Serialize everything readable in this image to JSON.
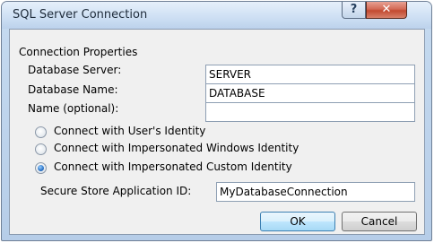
{
  "window": {
    "title": "SQL Server Connection"
  },
  "titlebar": {
    "help_glyph": "?",
    "close_glyph": "✕"
  },
  "section": {
    "heading": "Connection Properties"
  },
  "fields": {
    "server_label": "Database Server:",
    "server_value": "SERVER",
    "name_label": "Database Name:",
    "name_value": "DATABASE",
    "optional_label": "Name (optional):",
    "optional_value": ""
  },
  "identity": {
    "options": [
      {
        "label": "Connect with User's Identity",
        "checked": false
      },
      {
        "label": "Connect with Impersonated Windows Identity",
        "checked": false
      },
      {
        "label": "Connect with Impersonated Custom Identity",
        "checked": true
      }
    ]
  },
  "secure_store": {
    "label": "Secure Store Application ID:",
    "value": "MyDatabaseConnection"
  },
  "buttons": {
    "ok": "OK",
    "cancel": "Cancel"
  }
}
